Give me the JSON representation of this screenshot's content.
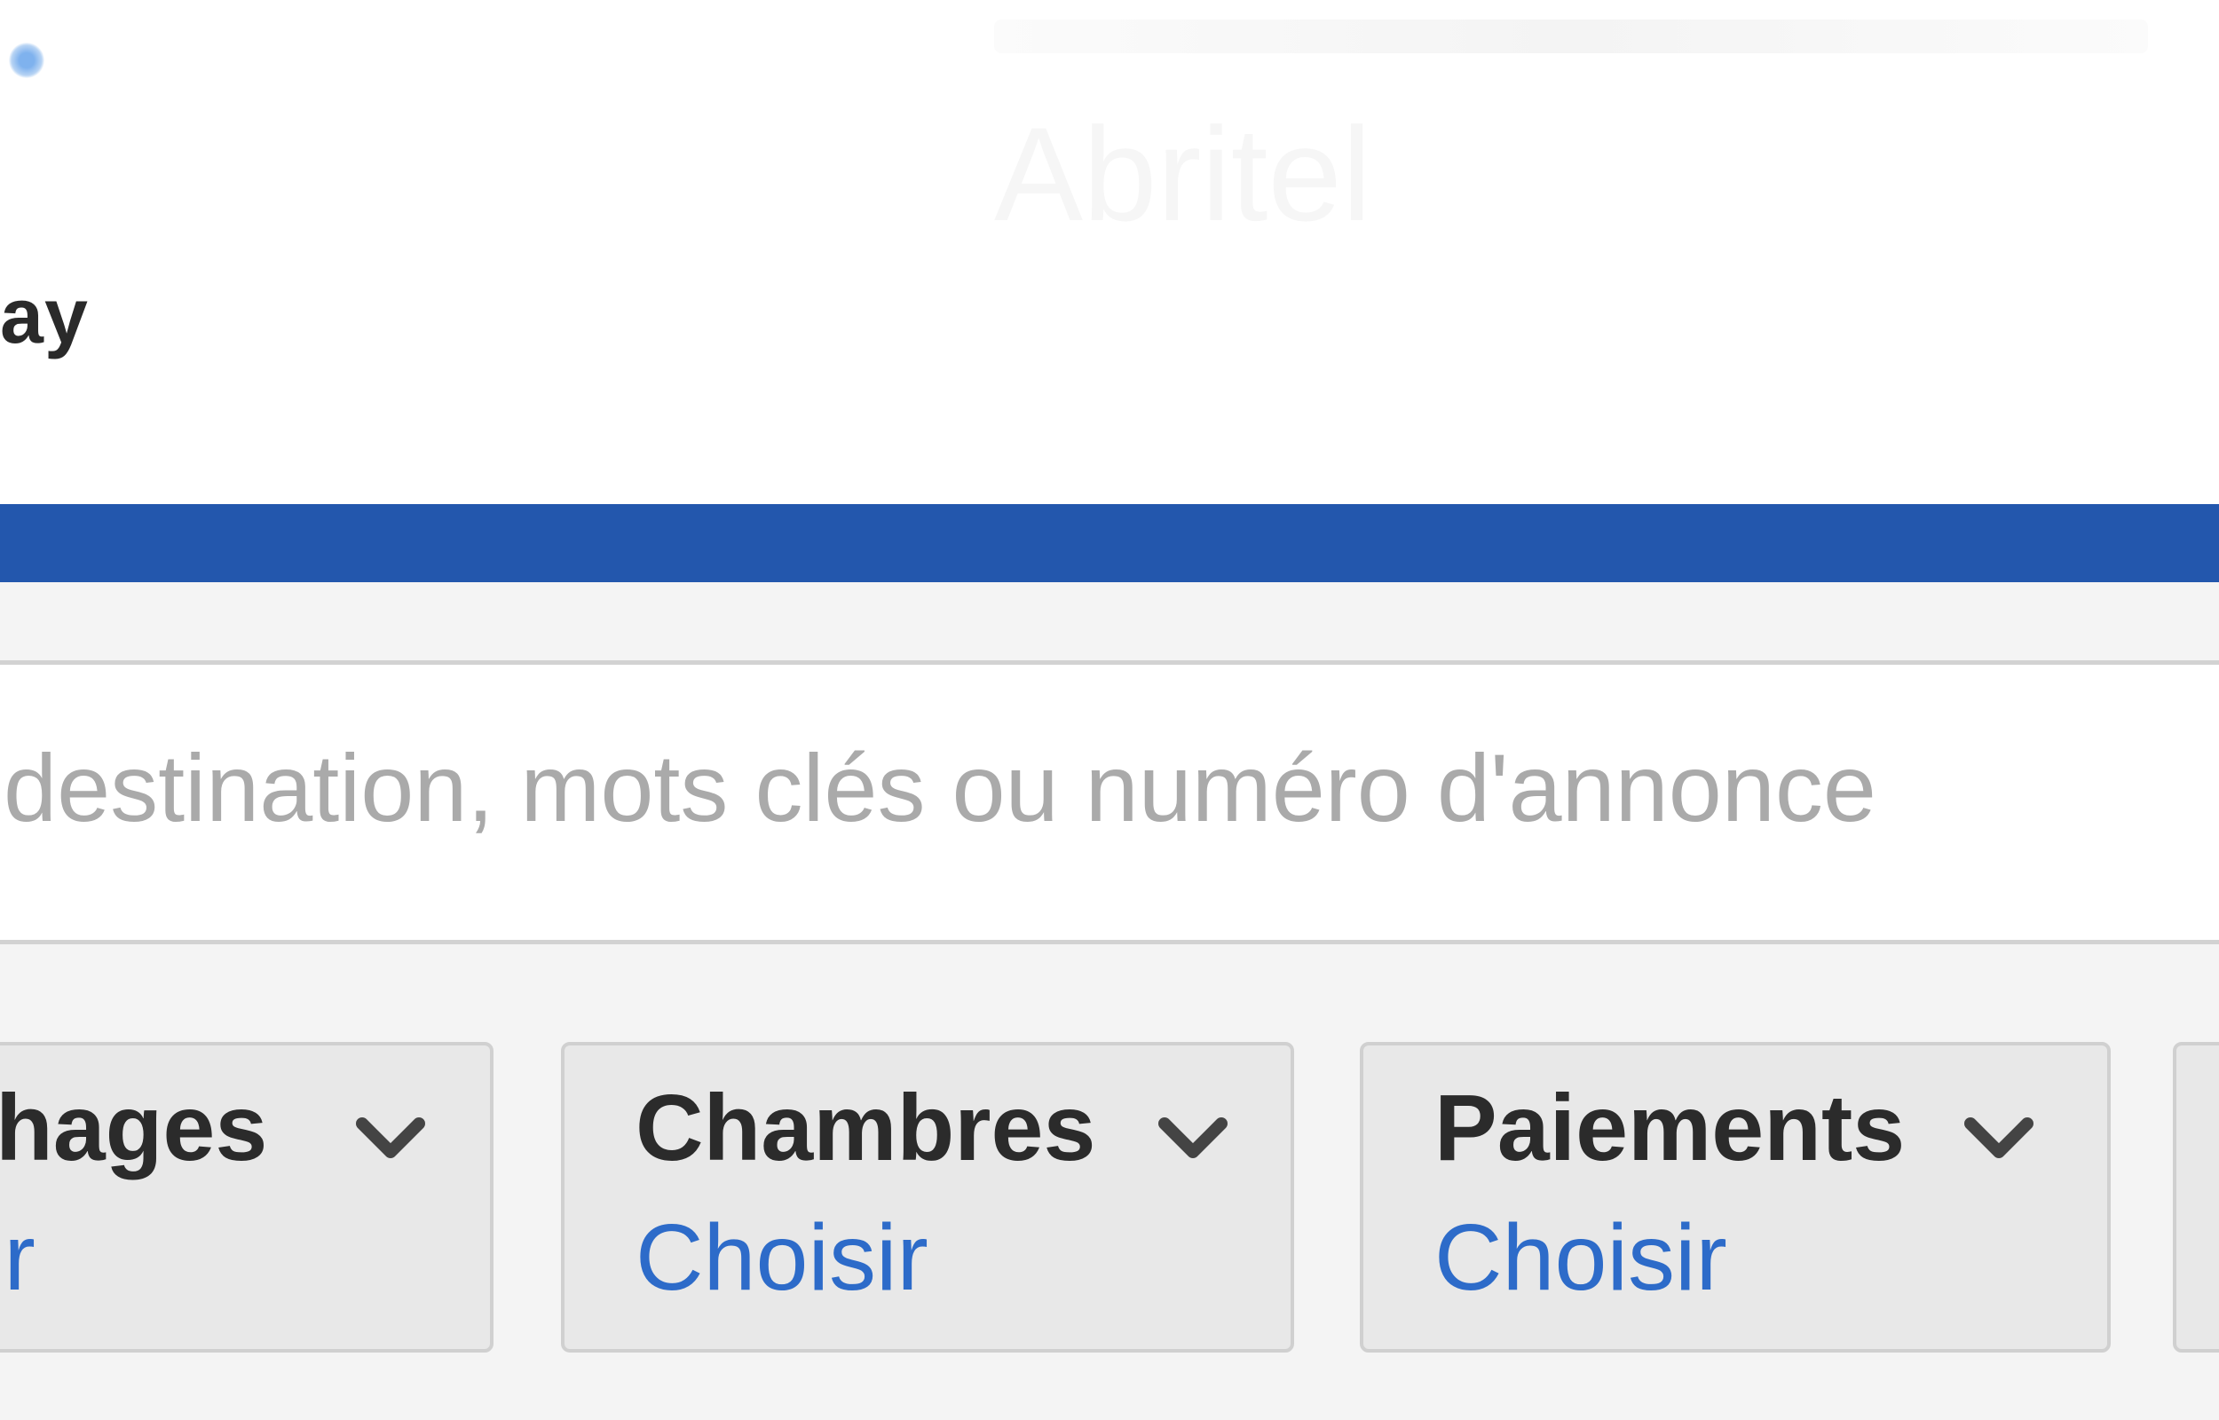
{
  "header": {
    "brand_fragment": "ay",
    "ghost_text": "Abritel"
  },
  "search": {
    "placeholder": "destination, mots clés ou numéro d'annonce"
  },
  "filters": [
    {
      "label": "chages",
      "value": "sir"
    },
    {
      "label": "Chambres",
      "value": "Choisir"
    },
    {
      "label": "Paiements",
      "value": "Choisir"
    }
  ],
  "colors": {
    "brand_blue": "#2357ad",
    "link_blue": "#2d6bc9",
    "filter_bg": "#e8e8e8",
    "page_bg": "#f4f4f4"
  },
  "icons": {
    "logo": "logo-dot-icon",
    "dropdown": "chevron-down-icon"
  }
}
